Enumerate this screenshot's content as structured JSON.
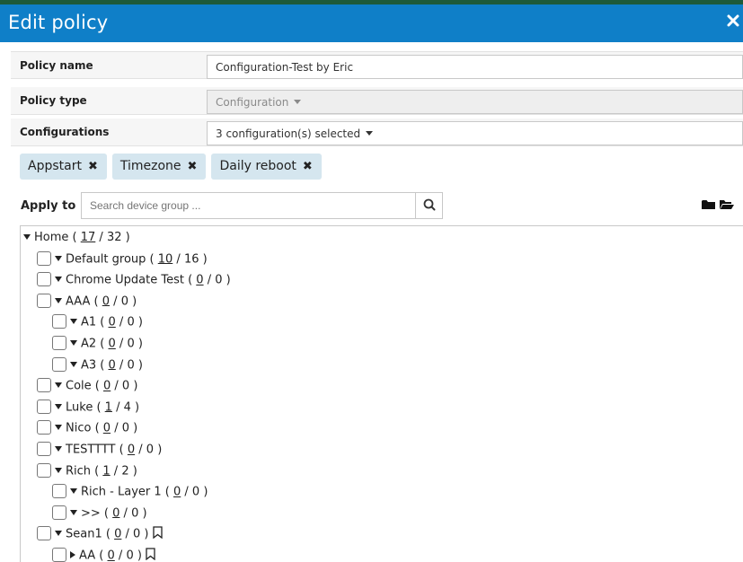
{
  "dialog": {
    "title": "Edit policy",
    "close_glyph": "✕"
  },
  "form": {
    "policy_name_label": "Policy name",
    "policy_name_value": "Configuration-Test by Eric",
    "policy_type_label": "Policy type",
    "policy_type_value": "Configuration",
    "configurations_label": "Configurations",
    "configurations_value": "3 configuration(s) selected"
  },
  "chips": [
    {
      "label": "Appstart"
    },
    {
      "label": "Timezone"
    },
    {
      "label": "Daily reboot"
    }
  ],
  "apply_to": {
    "label": "Apply to",
    "search_placeholder": "Search device group ..."
  },
  "icons": {
    "search": "search-icon",
    "folder_closed": "folder-icon",
    "folder_open": "folder-open-icon",
    "remove": "close-icon",
    "bookmark": "bookmark-icon"
  },
  "tree": [
    {
      "name": "Home",
      "selected": "17",
      "total": "32",
      "level": 0,
      "checkbox": false,
      "bookmark": false
    },
    {
      "name": "Default group",
      "selected": "10",
      "total": "16",
      "level": 1,
      "checkbox": true,
      "bookmark": false
    },
    {
      "name": "Chrome Update Test",
      "selected": "0",
      "total": "0",
      "level": 1,
      "checkbox": true,
      "bookmark": false
    },
    {
      "name": "AAA",
      "selected": "0",
      "total": "0",
      "level": 1,
      "checkbox": true,
      "bookmark": false
    },
    {
      "name": "A1",
      "selected": "0",
      "total": "0",
      "level": 2,
      "checkbox": true,
      "bookmark": false
    },
    {
      "name": "A2",
      "selected": "0",
      "total": "0",
      "level": 2,
      "checkbox": true,
      "bookmark": false
    },
    {
      "name": "A3",
      "selected": "0",
      "total": "0",
      "level": 2,
      "checkbox": true,
      "bookmark": false
    },
    {
      "name": "Cole",
      "selected": "0",
      "total": "0",
      "level": 1,
      "checkbox": true,
      "bookmark": false
    },
    {
      "name": "Luke",
      "selected": "1",
      "total": "4",
      "level": 1,
      "checkbox": true,
      "bookmark": false
    },
    {
      "name": "Nico",
      "selected": "0",
      "total": "0",
      "level": 1,
      "checkbox": true,
      "bookmark": false
    },
    {
      "name": "TESTTTT",
      "selected": "0",
      "total": "0",
      "level": 1,
      "checkbox": true,
      "bookmark": false
    },
    {
      "name": "Rich",
      "selected": "1",
      "total": "2",
      "level": 1,
      "checkbox": true,
      "bookmark": false
    },
    {
      "name": "Rich - Layer 1",
      "selected": "0",
      "total": "0",
      "level": 2,
      "checkbox": true,
      "bookmark": false
    },
    {
      "name": ">>",
      "selected": "0",
      "total": "0",
      "level": 2,
      "checkbox": true,
      "bookmark": false
    },
    {
      "name": "Sean1",
      "selected": "0",
      "total": "0",
      "level": 1,
      "checkbox": true,
      "bookmark": true
    },
    {
      "name": "AA",
      "selected": "0",
      "total": "0",
      "level": 2,
      "checkbox": true,
      "bookmark": true,
      "collapsed": true
    }
  ]
}
